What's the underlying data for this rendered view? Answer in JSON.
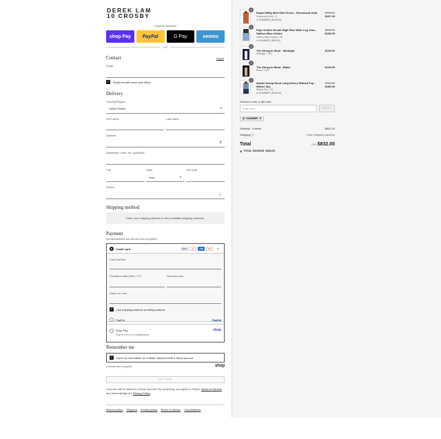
{
  "brand": {
    "line1": "DEREK LAM",
    "line2": "10 CROSBY"
  },
  "express": {
    "label": "Express checkout",
    "buttons": [
      "shop Pay",
      "PayPal",
      "G Pay",
      "venmo"
    ],
    "or": "OR"
  },
  "contact": {
    "title": "Contact",
    "login": "Log in",
    "email_label": "Email",
    "news_label": "Email me with news and offers"
  },
  "delivery": {
    "title": "Delivery",
    "country_label": "Country/Region",
    "country_value": "United States",
    "first_name": "First name",
    "last_name": "Last name",
    "address": "Address",
    "apartment": "Apartment, suite, etc. (optional)",
    "city": "City",
    "state_label": "State",
    "state_value": "Iowa",
    "zip": "ZIP code",
    "phone": "Phone"
  },
  "shipping": {
    "title": "Shipping method",
    "message": "Enter your shipping address to view available shipping methods."
  },
  "payment": {
    "title": "Payment",
    "subtitle": "All transactions are secure and encrypted.",
    "credit_card": "Credit card",
    "card_number": "Card number",
    "expiration": "Expiration date (MM / YY)",
    "security": "Security code",
    "name_on_card": "Name on card",
    "billing_same": "Use shipping address as billing address",
    "paypal": "PayPal",
    "paypal_logo": "PayPal",
    "shoppay": "Shop Pay",
    "shoppay_sub": "Pay in full or in installments",
    "shoppay_logo": "shop"
  },
  "remember": {
    "title": "Remember me",
    "label": "Save my information for a faster checkout with a Shop account",
    "secure": "Secure and encrypted",
    "shop_logo": "shop"
  },
  "pay_now": "PAY NOW",
  "legal": {
    "text": "Your info will be saved to a Shop account. By continuing, you agree to Shop's",
    "terms": "Terms of Service",
    "and": "and acknowledge the",
    "privacy": "Privacy Policy"
  },
  "footer": [
    "Refund policy",
    "Shipping",
    "Privacy policy",
    "Terms of service",
    "Cancellations"
  ],
  "items": [
    {
      "qty": "1",
      "name": "Kayla Utility Mini Shirt Dress - Rosewood Gold",
      "variant": "Rosewood Gold / 0",
      "discount": "SUMMER (-$118.00)",
      "original": "$415.00",
      "price": "$297.00"
    },
    {
      "qty": "1",
      "name": "Faye Ombre Denim High Rise Wide Leg Jean - Saffron Blue Ombre",
      "variant": "Saffron Blue Ombre / 28",
      "discount": "SUMMER (-$90.00)",
      "original": "$225.00",
      "price": "$135.00"
    },
    {
      "qty": "1",
      "name": "The Shrug in Wool - Midnight",
      "variant": "Midnight / 1XS",
      "discount": "",
      "original": "",
      "price": "$125.00"
    },
    {
      "qty": "1",
      "name": "The Shrug in Wool - Black",
      "variant": "Black / 1XS",
      "discount": "",
      "original": "",
      "price": "$125.00"
    },
    {
      "qty": "1",
      "name": "Aisiah Scoop Neck Long Sleeve Ribbed Top - Winter Sky",
      "variant": "Winter Sky / XS",
      "discount": "SUMMER (-$118.00)",
      "original": "$298.00",
      "price": "$150.00"
    }
  ],
  "discount": {
    "placeholder": "Discount code or gift card",
    "input_placeholder": "Enter here",
    "apply": "APPLY",
    "tag": "SUMMER"
  },
  "summary": {
    "subtotal_label": "Subtotal · 5 items",
    "subtotal": "$832.00",
    "shipping_label": "Shipping",
    "shipping_value": "Enter shipping address",
    "total_label": "Total",
    "currency": "USD",
    "total": "$832.00",
    "savings_label": "TOTAL SAVINGS",
    "savings": "$368.00"
  },
  "colors": {
    "shoppay": "#5a31f4",
    "paypal": "#ffc439",
    "venmo": "#3d95ce",
    "accent": "#111111"
  }
}
